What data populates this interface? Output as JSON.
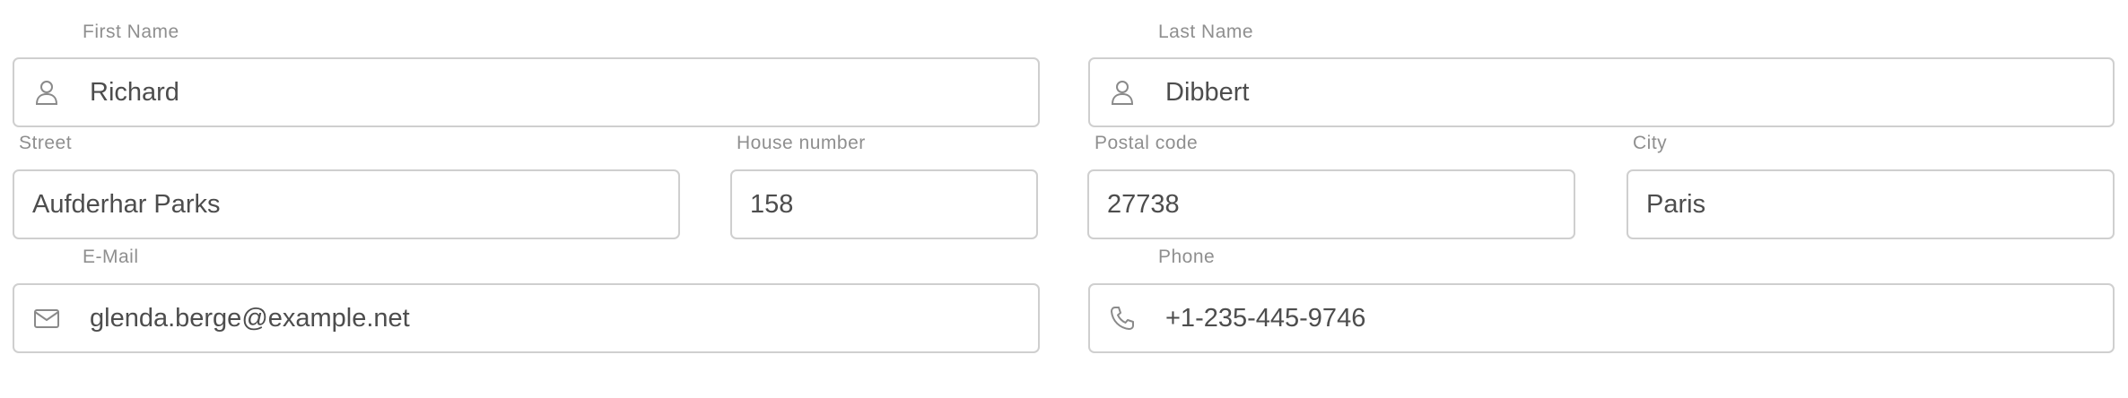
{
  "form": {
    "first_name": {
      "label": "First Name",
      "value": "Richard",
      "icon": "user-icon"
    },
    "last_name": {
      "label": "Last Name",
      "value": "Dibbert",
      "icon": "user-icon"
    },
    "street": {
      "label": "Street",
      "value": "Aufderhar Parks"
    },
    "house_number": {
      "label": "House number",
      "value": "158"
    },
    "postal_code": {
      "label": "Postal code",
      "value": "27738"
    },
    "city": {
      "label": "City",
      "value": "Paris"
    },
    "email": {
      "label": "E-Mail",
      "value": "glenda.berge@example.net",
      "icon": "mail-icon"
    },
    "phone": {
      "label": "Phone",
      "value": "+1-235-445-9746",
      "icon": "phone-icon"
    }
  },
  "colors": {
    "border": "#cfcfcf",
    "label": "#8f8f8f",
    "text": "#4d4d4d",
    "icon": "#8a8a8a"
  }
}
